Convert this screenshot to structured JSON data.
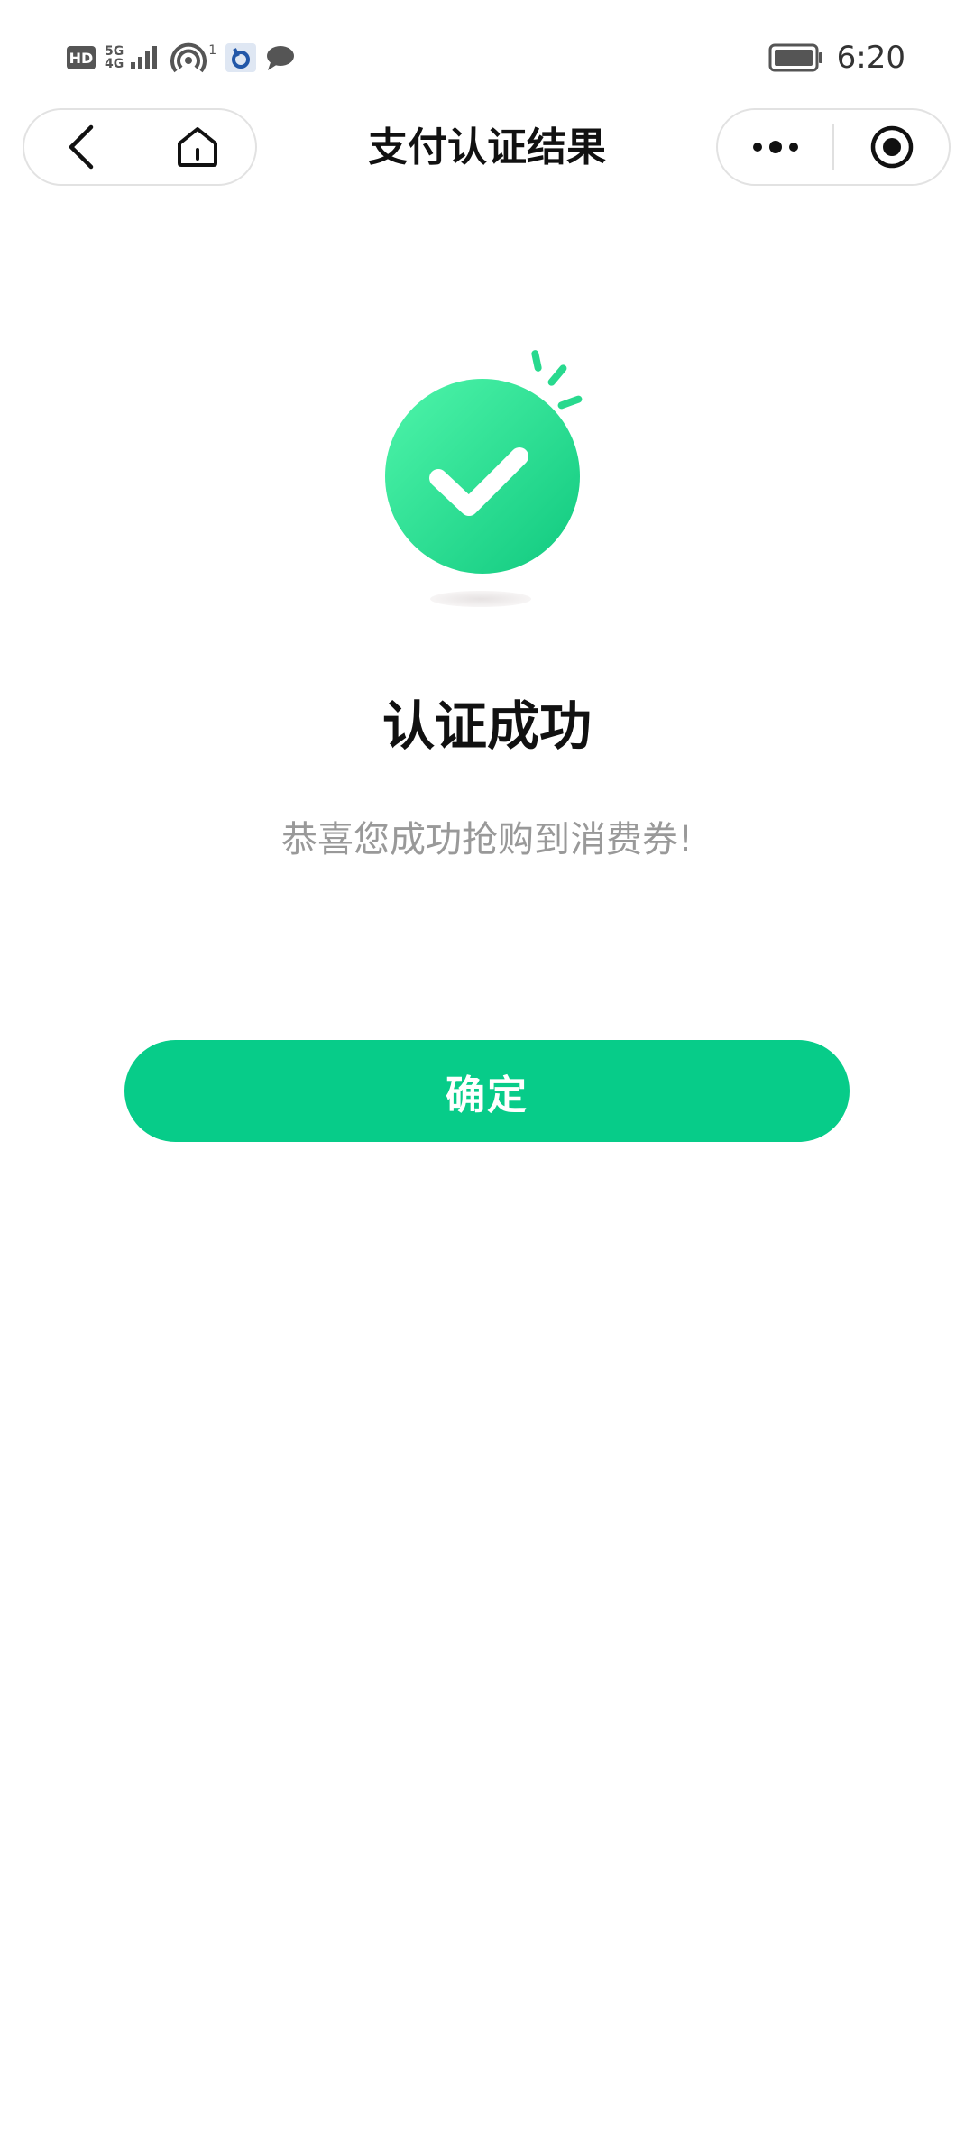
{
  "status_bar": {
    "hd": "HD",
    "net_top": "5G",
    "net_bottom": "4G",
    "hotspot_count": "1",
    "time": "6:20"
  },
  "nav": {
    "title": "支付认证结果"
  },
  "result": {
    "title": "认证成功",
    "message": "恭喜您成功抢购到消费券!"
  },
  "actions": {
    "confirm_label": "确定"
  },
  "colors": {
    "accent": "#07cc89",
    "icon_light": "#4ff5aa",
    "icon_dark": "#10c97f",
    "text_secondary": "#999999"
  }
}
